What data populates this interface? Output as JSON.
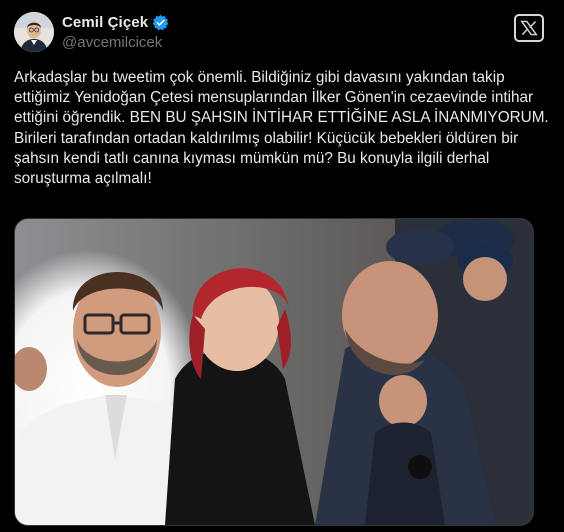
{
  "author": {
    "display_name": "Cemil Çiçek",
    "handle": "@avcemilcicek",
    "verified": true
  },
  "tweet": {
    "text": "Arkadaşlar bu tweetim çok önemli. Bildiğiniz gibi davasını yakından takip ettiğimiz Yenidoğan Çetesi mensuplarından İlker Gönen'in cezaevinde intihar ettiğini öğrendik. BEN BU ŞAHSIN İNTİHAR ETTİĞİNE ASLA İNANMIYORUM. Birileri tarafından ortadan kaldırılmış olabilir! Küçücük bebekleri öldüren bir şahsın kendi tatlı canına kıyması mümkün mü? Bu konuyla ilgili derhal soruşturma açılmalı!"
  },
  "icons": {
    "verified": "verified-badge-icon",
    "logo": "x-logo-icon"
  },
  "colors": {
    "background": "#000000",
    "text": "#e7e9ea",
    "secondary_text": "#71767b",
    "verified": "#1d9bf0"
  }
}
